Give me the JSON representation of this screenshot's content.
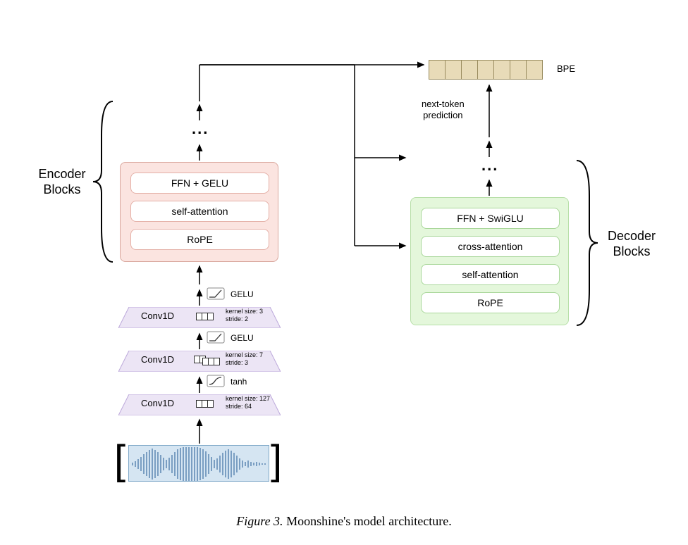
{
  "caption": {
    "fig": "Figure 3.",
    "text": " Moonshine's model architecture."
  },
  "encoder": {
    "side_label": "Encoder\nBlocks",
    "layers": [
      "FFN + GELU",
      "self-attention",
      "RoPE"
    ]
  },
  "decoder": {
    "side_label": "Decoder\nBlocks",
    "layers": [
      "FFN + SwiGLU",
      "cross-attention",
      "self-attention",
      "RoPE"
    ]
  },
  "conv": [
    {
      "label": "Conv1D",
      "kernel": "kernel size: 3",
      "stride": "stride: 2",
      "act": "GELU"
    },
    {
      "label": "Conv1D",
      "kernel": "kernel size: 7",
      "stride": "stride: 3",
      "act": "GELU"
    },
    {
      "label": "Conv1D",
      "kernel": "kernel size: 127",
      "stride": "stride: 64",
      "act": "tanh"
    }
  ],
  "bpe": {
    "label": "BPE"
  },
  "next_token": "next-token\nprediction",
  "ellipsis": "..."
}
